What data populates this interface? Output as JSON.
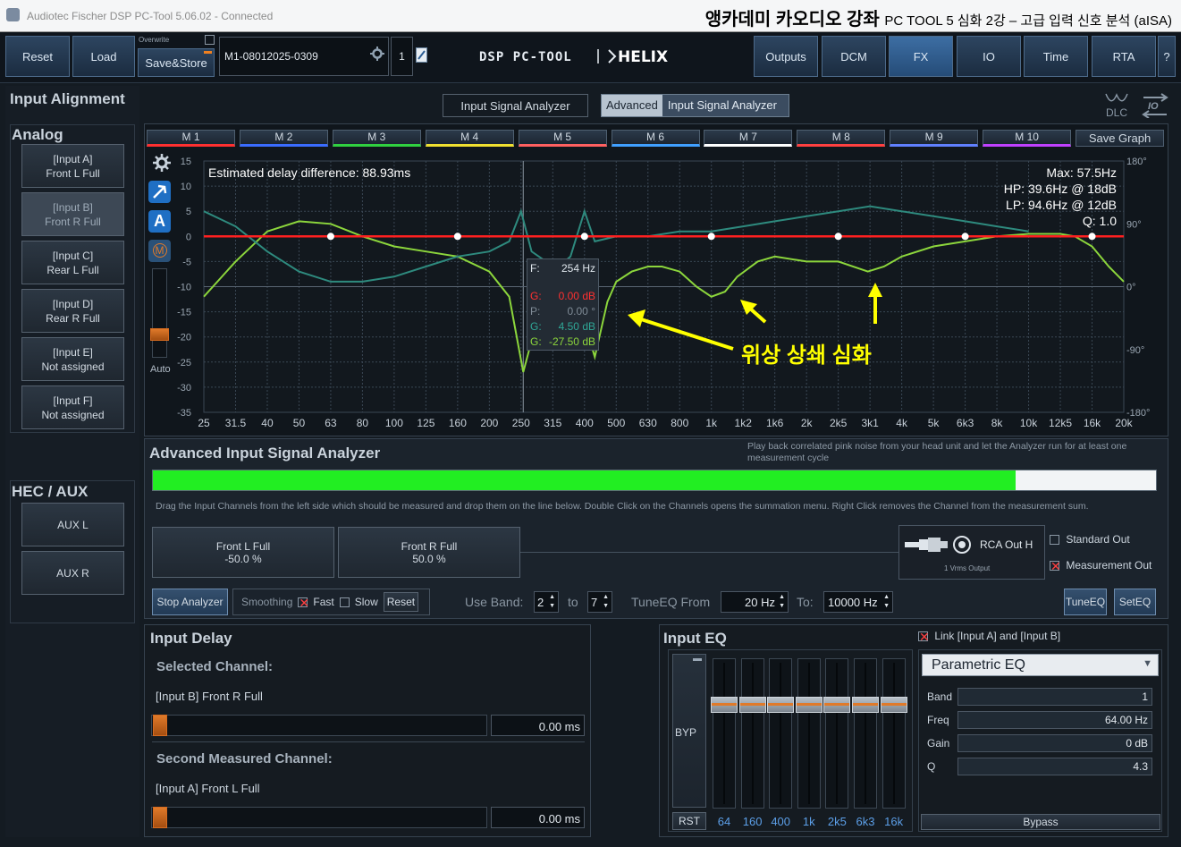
{
  "titlebar": {
    "app_title": "Audiotec Fischer DSP PC-Tool 5.06.02 - Connected",
    "overlay_main": "앵카데미 카오디오 강좌",
    "overlay_sub": "PC TOOL 5 심화 2강 – 고급 입력 신호 분석 (aISA)"
  },
  "toolbar": {
    "reset": "Reset",
    "load": "Load",
    "overwrite": "Overwrite",
    "save_store": "Save&Store",
    "preset_name": "M1-08012025-0309",
    "preset_number": "1",
    "logo": "DSP PC-TOOL | HELIX",
    "nav": [
      "Outputs",
      "DCM",
      "FX",
      "IO",
      "Time",
      "RTA"
    ],
    "active_nav": "FX",
    "help": "?"
  },
  "left": {
    "input_alignment": "Input Alignment",
    "analog": "Analog",
    "inputs": [
      {
        "line1": "[Input A]",
        "line2": "Front L Full"
      },
      {
        "line1": "[Input B]",
        "line2": "Front R Full"
      },
      {
        "line1": "[Input C]",
        "line2": "Rear L Full"
      },
      {
        "line1": "[Input D]",
        "line2": "Rear R Full"
      },
      {
        "line1": "[Input E]",
        "line2": "Not assigned"
      },
      {
        "line1": "[Input F]",
        "line2": "Not assigned"
      }
    ],
    "hec_aux": "HEC / AUX",
    "aux": [
      "AUX L",
      "AUX R"
    ]
  },
  "tabs": {
    "isa": "Input Signal Analyzer",
    "advanced_badge": "Advanced",
    "aisa": "Input Signal Analyzer",
    "dlc": "DLC",
    "io_icon": "IO"
  },
  "memory": {
    "buttons": [
      "M 1",
      "M 2",
      "M 3",
      "M 4",
      "M 5",
      "M 6",
      "M 7",
      "M 8",
      "M 9",
      "M 10"
    ],
    "colors": [
      "#ff3030",
      "#3a6cff",
      "#30d040",
      "#f0e030",
      "#ff6060",
      "#40a0ff",
      "#ffffff",
      "#ff4040",
      "#6080ff",
      "#c040ff"
    ],
    "save_graph": "Save Graph"
  },
  "graph": {
    "estimated_delay": "Estimated delay difference: 88.93ms",
    "max": "Max: 57.5Hz",
    "hp": "HP: 39.6Hz @ 18dB",
    "lp": "LP: 94.6Hz @ 12dB",
    "q": "Q: 1.0",
    "auto": "Auto",
    "mag_icon": "A",
    "m_icon": "M",
    "tooltip": {
      "f_label": "F:",
      "f_value": "254 Hz",
      "g1_label": "G:",
      "g1_value": "0.00 dB",
      "p_label": "P:",
      "p_value": "0.00 °",
      "g2_label": "G:",
      "g2_value": "4.50 dB",
      "g3_label": "G:",
      "g3_value": "-27.50 dB"
    },
    "annotation": "위상 상쇄 심화",
    "annotation_color": "#ffff00",
    "grid_color": "#3a4754",
    "curve_green": "#8cd63c",
    "curve_teal": "#2e8a7e",
    "curve_red": "#ff2020"
  },
  "chart_data": {
    "type": "line",
    "title": "",
    "x_scale": "log",
    "xlim": [
      25,
      20000
    ],
    "ylim": [
      -35,
      15
    ],
    "ylim_right": [
      -180,
      180
    ],
    "x_ticks": [
      "25",
      "31.5",
      "40",
      "50",
      "63",
      "80",
      "100",
      "125",
      "160",
      "200",
      "250",
      "315",
      "400",
      "500",
      "630",
      "800",
      "1k",
      "1k2",
      "1k6",
      "2k",
      "2k5",
      "3k1",
      "4k",
      "5k",
      "6k3",
      "8k",
      "10k",
      "12k5",
      "16k",
      "20k"
    ],
    "y_ticks": [
      "15",
      "10",
      "5",
      "0",
      "-5",
      "-10",
      "-15",
      "-20",
      "-25",
      "-30",
      "-35"
    ],
    "y_ticks_right": [
      "180°",
      "90°",
      "0°",
      "-90°",
      "-180°"
    ],
    "series": [
      {
        "color": "#8cd63c",
        "x": [
          25,
          31.5,
          40,
          50,
          63,
          80,
          100,
          125,
          160,
          200,
          230,
          254,
          280,
          315,
          360,
          400,
          430,
          470,
          500,
          560,
          630,
          700,
          800,
          900,
          1000,
          1100,
          1200,
          1400,
          1600,
          2000,
          2500,
          3100,
          3500,
          4000,
          5000,
          6300,
          8000,
          10000,
          12500,
          14000,
          16000,
          18000,
          20000
        ],
        "y": [
          -12,
          -5,
          1,
          3,
          2.5,
          0,
          -2,
          -3,
          -4,
          -7,
          -12,
          -27,
          -17,
          -14,
          -16,
          -17,
          -24,
          -13,
          -9,
          -7,
          -6,
          -6,
          -7,
          -10,
          -12,
          -11,
          -8,
          -5,
          -4,
          -5,
          -5,
          -7,
          -6,
          -4,
          -2,
          -1,
          0,
          0.5,
          0.5,
          0,
          -2,
          -6,
          -9
        ]
      },
      {
        "color": "#2e8a7e",
        "x": [
          25,
          31.5,
          40,
          50,
          63,
          80,
          100,
          125,
          160,
          200,
          230,
          250,
          270,
          300,
          330,
          360,
          400,
          430,
          500,
          630,
          800,
          1000,
          1250,
          1600,
          2000,
          2500,
          3150,
          4000,
          5000,
          6300,
          8000,
          10000
        ],
        "y": [
          5,
          2,
          -3,
          -7,
          -9,
          -9,
          -8,
          -6,
          -4,
          -3,
          -1,
          5,
          -3,
          -5,
          -6,
          -4,
          5,
          -1,
          0,
          0,
          1,
          1,
          2,
          3,
          4,
          5,
          6,
          5,
          4,
          3,
          2,
          1
        ]
      },
      {
        "color": "#ff2020",
        "x": [
          25,
          20000
        ],
        "y": [
          0,
          0
        ]
      }
    ],
    "markers_x": [
      63,
      160,
      400,
      1000,
      2500,
      6300,
      16000
    ],
    "cursor_x": 254
  },
  "aisa": {
    "title": "Advanced Input Signal Analyzer",
    "hint": "Play back correlated pink noise from your head unit and let the Analyzer run for at least one measurement cycle",
    "progress": 0.86,
    "drag_hint": "Drag the Input Channels from the left side which should be measured and drop them on the line below. Double Click on the Channels opens the summation menu. Right Click removes the Channel from the measurement sum.",
    "channels": [
      {
        "name": "Front L Full",
        "pct": "-50.0 %"
      },
      {
        "name": "Front R Full",
        "pct": "50.0 %"
      }
    ],
    "rca_out": "RCA Out H",
    "vrms": "1 Vrms Output",
    "standard_out": "Standard Out",
    "measurement_out": "Measurement Out",
    "stop_analyzer": "Stop Analyzer",
    "smoothing": "Smoothing",
    "fast": "Fast",
    "slow": "Slow",
    "reset": "Reset",
    "use_band": "Use Band:",
    "band_from": "2",
    "to": "to",
    "band_to": "7",
    "tuneeq_from": "TuneEQ From",
    "from_hz": "20 Hz",
    "to_label": "To:",
    "to_hz": "10000 Hz",
    "tuneeq": "TuneEQ",
    "seteq": "SetEQ"
  },
  "delay": {
    "title": "Input Delay",
    "selected_channel": "Selected Channel:",
    "selected_name": "[Input B] Front R Full",
    "selected_value": "0.00 ms",
    "second_channel": "Second Measured Channel:",
    "second_name": "[Input A] Front L Full",
    "second_value": "0.00 ms"
  },
  "eq": {
    "title": "Input EQ",
    "link": "Link [Input A] and [Input B]",
    "byp": "BYP",
    "rst": "RST",
    "bands": [
      "64",
      "160",
      "400",
      "1k",
      "2k5",
      "6k3",
      "16k"
    ],
    "type": "Parametric EQ",
    "band_label": "Band",
    "band_value": "1",
    "freq_label": "Freq",
    "freq_value": "64.00 Hz",
    "gain_label": "Gain",
    "gain_value": "0 dB",
    "q_label": "Q",
    "q_value": "4.3",
    "bypass": "Bypass"
  }
}
